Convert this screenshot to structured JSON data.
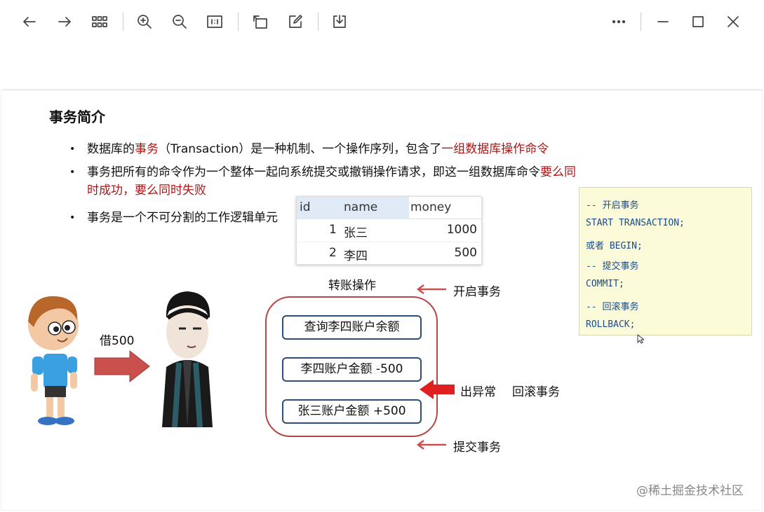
{
  "toolbar": {
    "buttons": [
      "back-icon",
      "forward-icon",
      "grid-icon",
      "zoom-in-icon",
      "zoom-out-icon",
      "actual-size-icon",
      "rotate-icon",
      "edit-icon",
      "download-icon",
      "more-icon",
      "minimize-icon",
      "maximize-icon",
      "close-icon"
    ]
  },
  "slide": {
    "title": "事务简介",
    "bullets": {
      "b1_a": "数据库的",
      "b1_b": "事务",
      "b1_c": "（Transaction）是一种机制、一个操作序列，包含了",
      "b1_d": "一组数据库操作命令",
      "b2_a": "事务把所有的命令作为一个整体一起向系统提交或撤销操作请求，即这一组数据库命令",
      "b2_b": "要么同",
      "b2_c": "时成功，要么同时失败",
      "b3": "事务是一个不可分割的工作逻辑单元"
    },
    "table": {
      "headers": [
        "id",
        "name",
        "money"
      ],
      "rows": [
        {
          "id": "1",
          "name": "张三",
          "money": "1000"
        },
        {
          "id": "2",
          "name": "李四",
          "money": "500"
        }
      ]
    },
    "code": [
      "-- 开启事务",
      "START TRANSACTION;",
      "或者  BEGIN;",
      "-- 提交事务",
      "COMMIT;",
      "-- 回滚事务",
      "ROLLBACK;"
    ],
    "borrow_label": "借500",
    "flow_title": "转账操作",
    "steps": [
      "查询李四账户余额",
      "李四账户金额 -500",
      "张三账户金额 +500"
    ],
    "start_tx": "开启事务",
    "exception": "出异常",
    "rollback": "回滚事务",
    "commit": "提交事务",
    "watermark": "@稀土掘金技术社区"
  }
}
